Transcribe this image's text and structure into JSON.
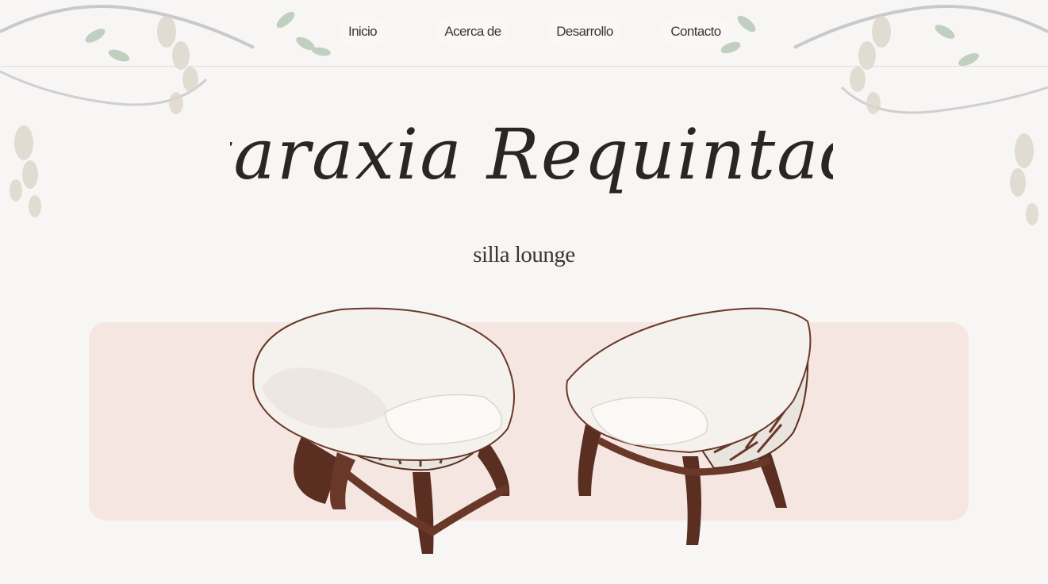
{
  "nav": {
    "items": [
      {
        "label": "Inicio"
      },
      {
        "label": "Acerca de"
      },
      {
        "label": "Desarrollo"
      },
      {
        "label": "Contacto"
      }
    ]
  },
  "hero": {
    "title": "Ataraxia Requintado",
    "subtitle": "silla lounge"
  },
  "colors": {
    "background": "#f7f6f4",
    "card": "#f6e6e1",
    "text": "#3b3634",
    "wood": "#5a2f22"
  },
  "images": [
    {
      "name": "wisteria-decoration-left"
    },
    {
      "name": "wisteria-decoration-right"
    },
    {
      "name": "lounge-chair-front"
    },
    {
      "name": "lounge-chair-angled"
    }
  ]
}
